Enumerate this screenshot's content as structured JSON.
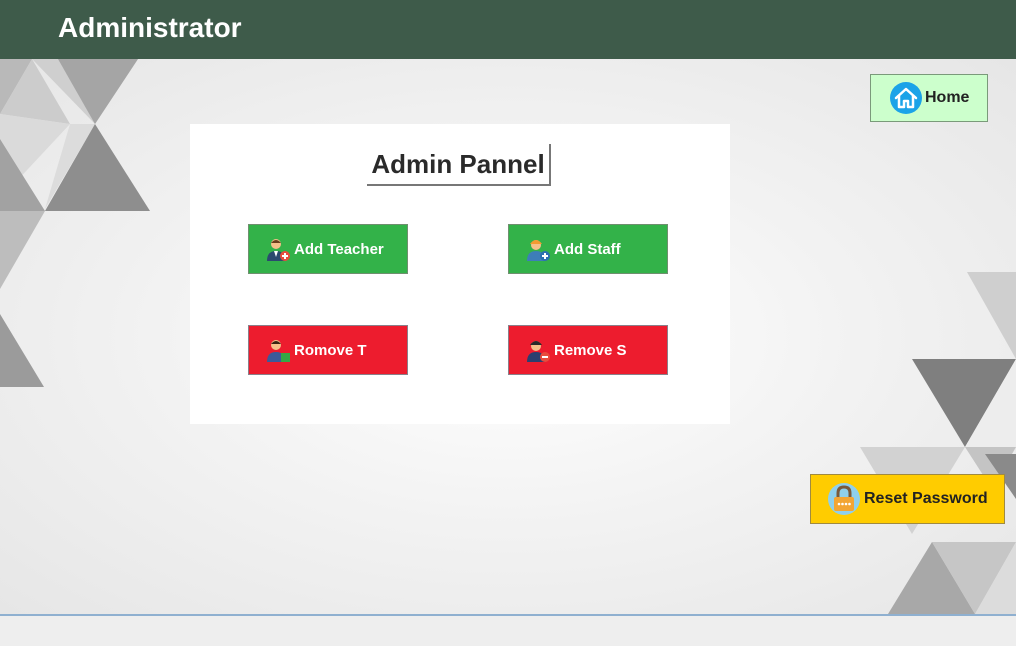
{
  "window": {
    "title": "Administrator"
  },
  "home_button": {
    "label": "Home",
    "icon": "home-icon"
  },
  "panel": {
    "title": "Admin Pannel",
    "actions": [
      {
        "label": "Add Teacher",
        "icon": "add-teacher-icon",
        "color": "#33b249"
      },
      {
        "label": "Add Staff",
        "icon": "add-staff-icon",
        "color": "#33b249"
      },
      {
        "label": "Romove T",
        "icon": "remove-teacher-icon",
        "color": "#ed1c2e"
      },
      {
        "label": "Remove S",
        "icon": "remove-staff-icon",
        "color": "#ed1c2e"
      }
    ]
  },
  "reset_button": {
    "label": "Reset Password",
    "icon": "lock-icon",
    "color": "#ffcc00"
  },
  "colors": {
    "titlebar": "#3e5b4a",
    "home_button": "#ccffcc",
    "panel": "#ffffff"
  }
}
